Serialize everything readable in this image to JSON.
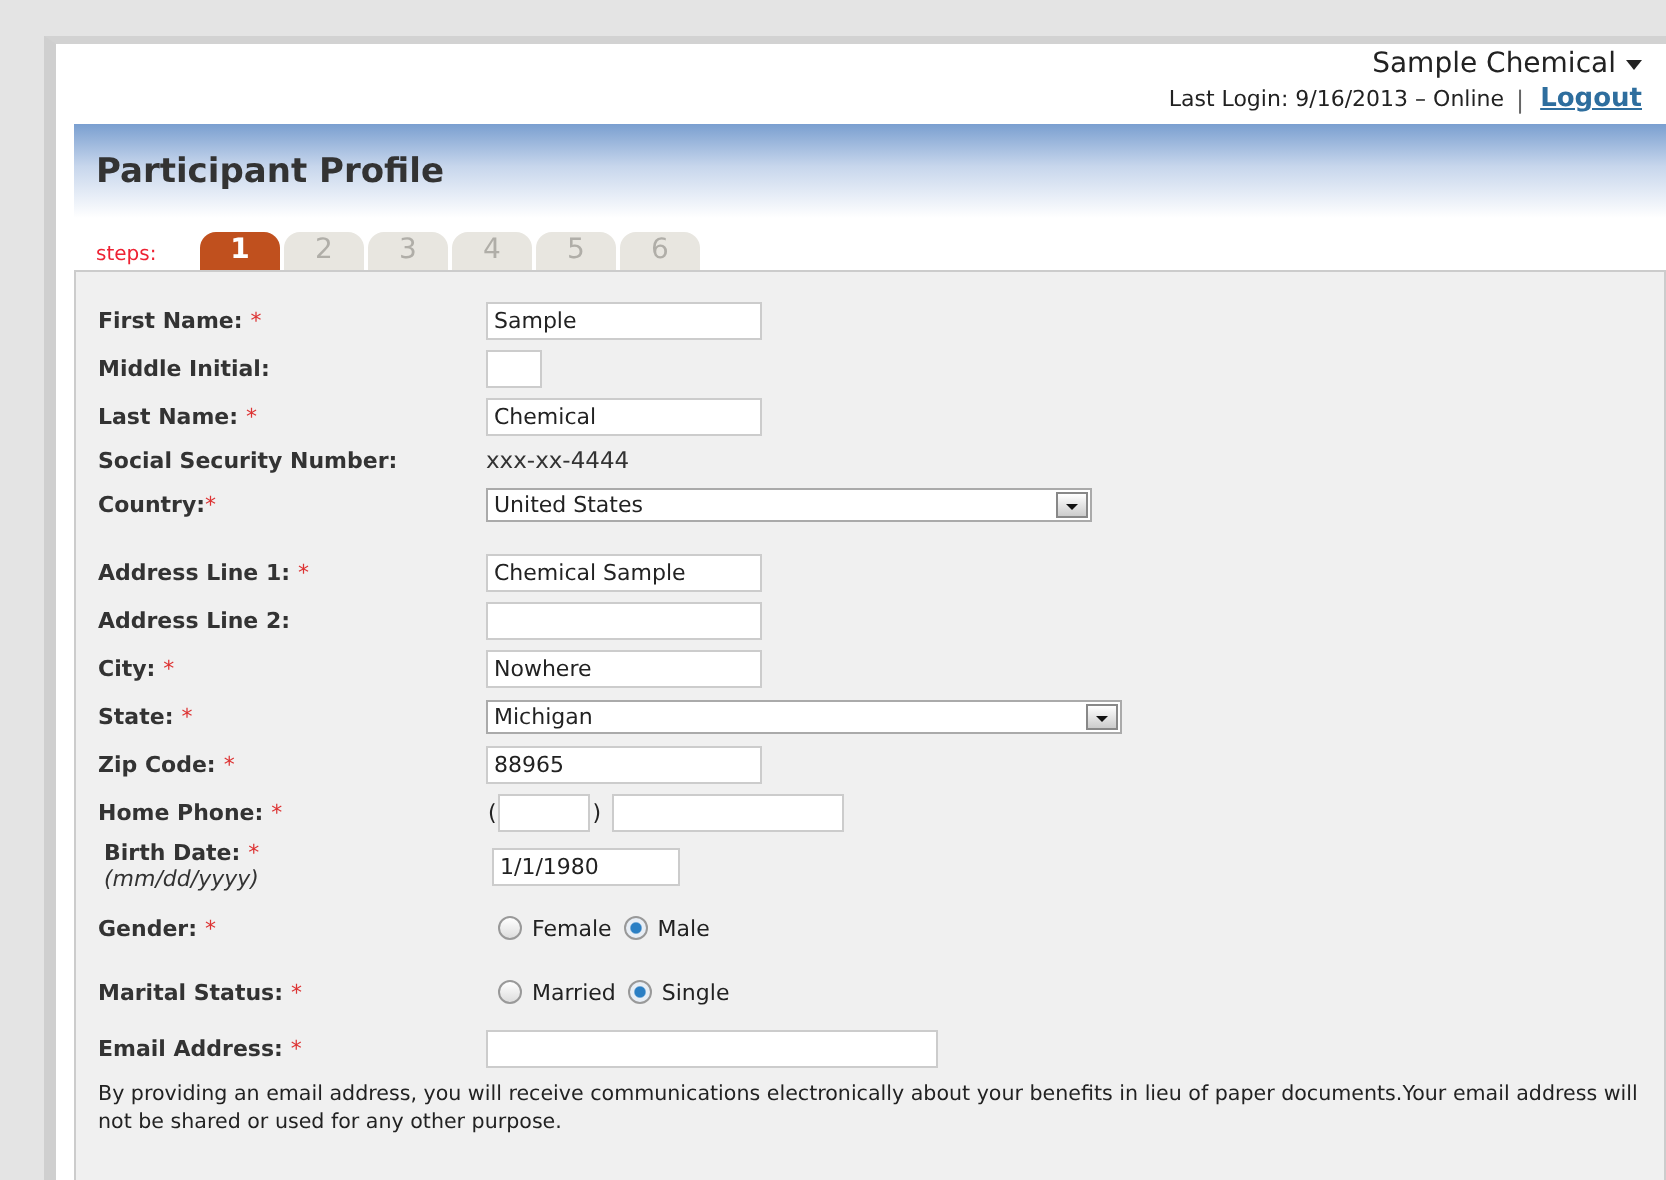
{
  "header": {
    "user": "Sample Chemical",
    "last_login": "Last Login: 9/16/2013 – Online",
    "separator": "|",
    "logout": "Logout"
  },
  "title": "Participant Profile",
  "steps": {
    "label": "steps:",
    "items": [
      {
        "label": "1",
        "selected": true
      },
      {
        "label": "2",
        "selected": false
      },
      {
        "label": "3",
        "selected": false
      },
      {
        "label": "4",
        "selected": false
      },
      {
        "label": "5",
        "selected": false
      },
      {
        "label": "6",
        "selected": false
      }
    ]
  },
  "sections": [
    {
      "fields": [
        {
          "kind": "text",
          "label": "First Name:",
          "required": "*",
          "value": "Sample"
        },
        {
          "kind": "initial",
          "label": "Middle Initial:"
        },
        {
          "kind": "text",
          "label": "Last Name:",
          "required": "*",
          "value": "Chemical"
        },
        {
          "kind": "static",
          "label": "Social Security Number:",
          "value": "xxx-xx-4444"
        },
        {
          "kind": "select",
          "label": "Country:",
          "required": "*",
          "value": "United States"
        }
      ]
    },
    {
      "fields": [
        {
          "kind": "text",
          "label": "Address Line 1:",
          "required": "*",
          "value": "Chemical Sample"
        },
        {
          "kind": "text",
          "label": "Address Line 2:"
        },
        {
          "kind": "text",
          "label": "City:",
          "required": "*",
          "value": "Nowhere"
        },
        {
          "kind": "select",
          "label": "State:",
          "required": "*",
          "value": "Michigan"
        },
        {
          "kind": "text",
          "label": "Zip Code:",
          "required": "*",
          "value": "88965"
        },
        {
          "kind": "phone",
          "label": "Home Phone:",
          "required": "*",
          "open": "(",
          "close": ")"
        },
        {
          "kind": "date",
          "label": "Birth Date:",
          "required": "*",
          "hint": "(mm/dd/yyyy)",
          "value": "1/1/1980"
        },
        {
          "kind": "radio",
          "label": "Gender:",
          "required": "*",
          "options": [
            {
              "label": "Female",
              "selected": false
            },
            {
              "label": "Male",
              "selected": true
            }
          ]
        },
        {
          "kind": "radio",
          "label": "Marital Status:",
          "required": "*",
          "options": [
            {
              "label": "Married",
              "selected": false
            },
            {
              "label": "Single",
              "selected": true
            }
          ]
        },
        {
          "kind": "email",
          "label": "Email Address:",
          "required": "*"
        }
      ]
    }
  ],
  "note": "By providing an email address, you will receive communications electronically about your benefits in lieu of paper documents.Your email address will not be shared or used for any other purpose."
}
